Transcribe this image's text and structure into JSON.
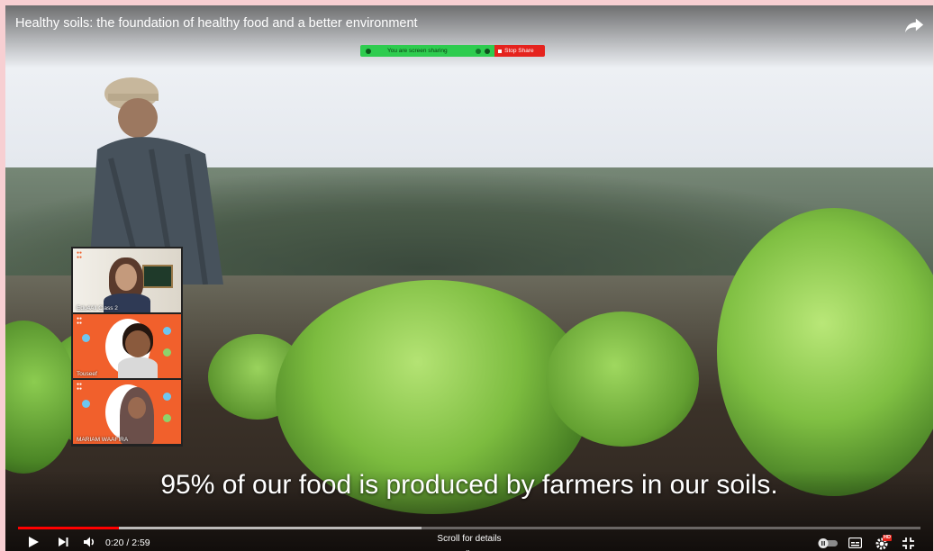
{
  "video": {
    "title": "Healthy soils: the foundation of healthy food and a better environment",
    "caption": "95% of our food is produced by farmers in our soils.",
    "time_display": "0:20 / 2:59",
    "played_fraction": 0.112,
    "buffered_fraction": 0.447,
    "scroll_hint": "Scroll for details",
    "hd_badge": "HD"
  },
  "screen_share": {
    "message": "You are screen sharing",
    "stop_label": "Stop Share",
    "colors": {
      "bar": "#2ecc4f",
      "stop": "#e5231e"
    }
  },
  "gallery": {
    "participants": [
      {
        "name": "Edu4All Class 2",
        "style": "camera"
      },
      {
        "name": "Touseef",
        "style": "orange"
      },
      {
        "name": "MARIAM WAAFIRA",
        "style": "orange"
      }
    ]
  },
  "icons": {
    "share": "share-arrow-icon",
    "play": "play-icon",
    "next": "next-icon",
    "volume": "volume-icon",
    "autoplay": "autoplay-toggle-icon",
    "subtitles": "subtitles-icon",
    "settings": "settings-gear-icon",
    "fullscreen": "exit-fullscreen-icon"
  },
  "colors": {
    "progress_played": "#ff0000",
    "page_border": "#f7cfd2"
  }
}
